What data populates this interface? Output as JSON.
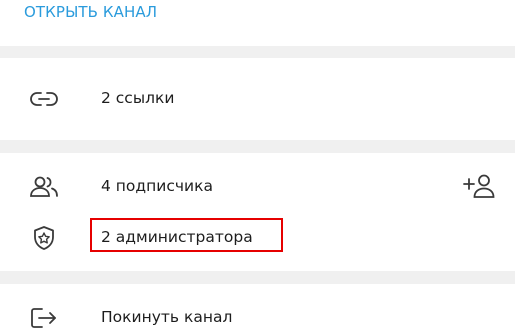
{
  "open_channel": {
    "label": "ОТКРЫТЬ КАНАЛ"
  },
  "links": {
    "label": "2 ссылки",
    "icon": "link-icon"
  },
  "subscribers": {
    "label": "4 подписчика",
    "icon": "users-icon",
    "add_icon": "add-user-icon"
  },
  "admins": {
    "label": "2 администратора",
    "icon": "shield-star-icon"
  },
  "leave": {
    "label": "Покинуть канал",
    "icon": "leave-icon"
  },
  "colors": {
    "accent": "#2a9bdc",
    "highlight": "#e60000",
    "text": "#1d1d1d",
    "icon": "#3a3a3a",
    "background": "#f0f0f0"
  }
}
